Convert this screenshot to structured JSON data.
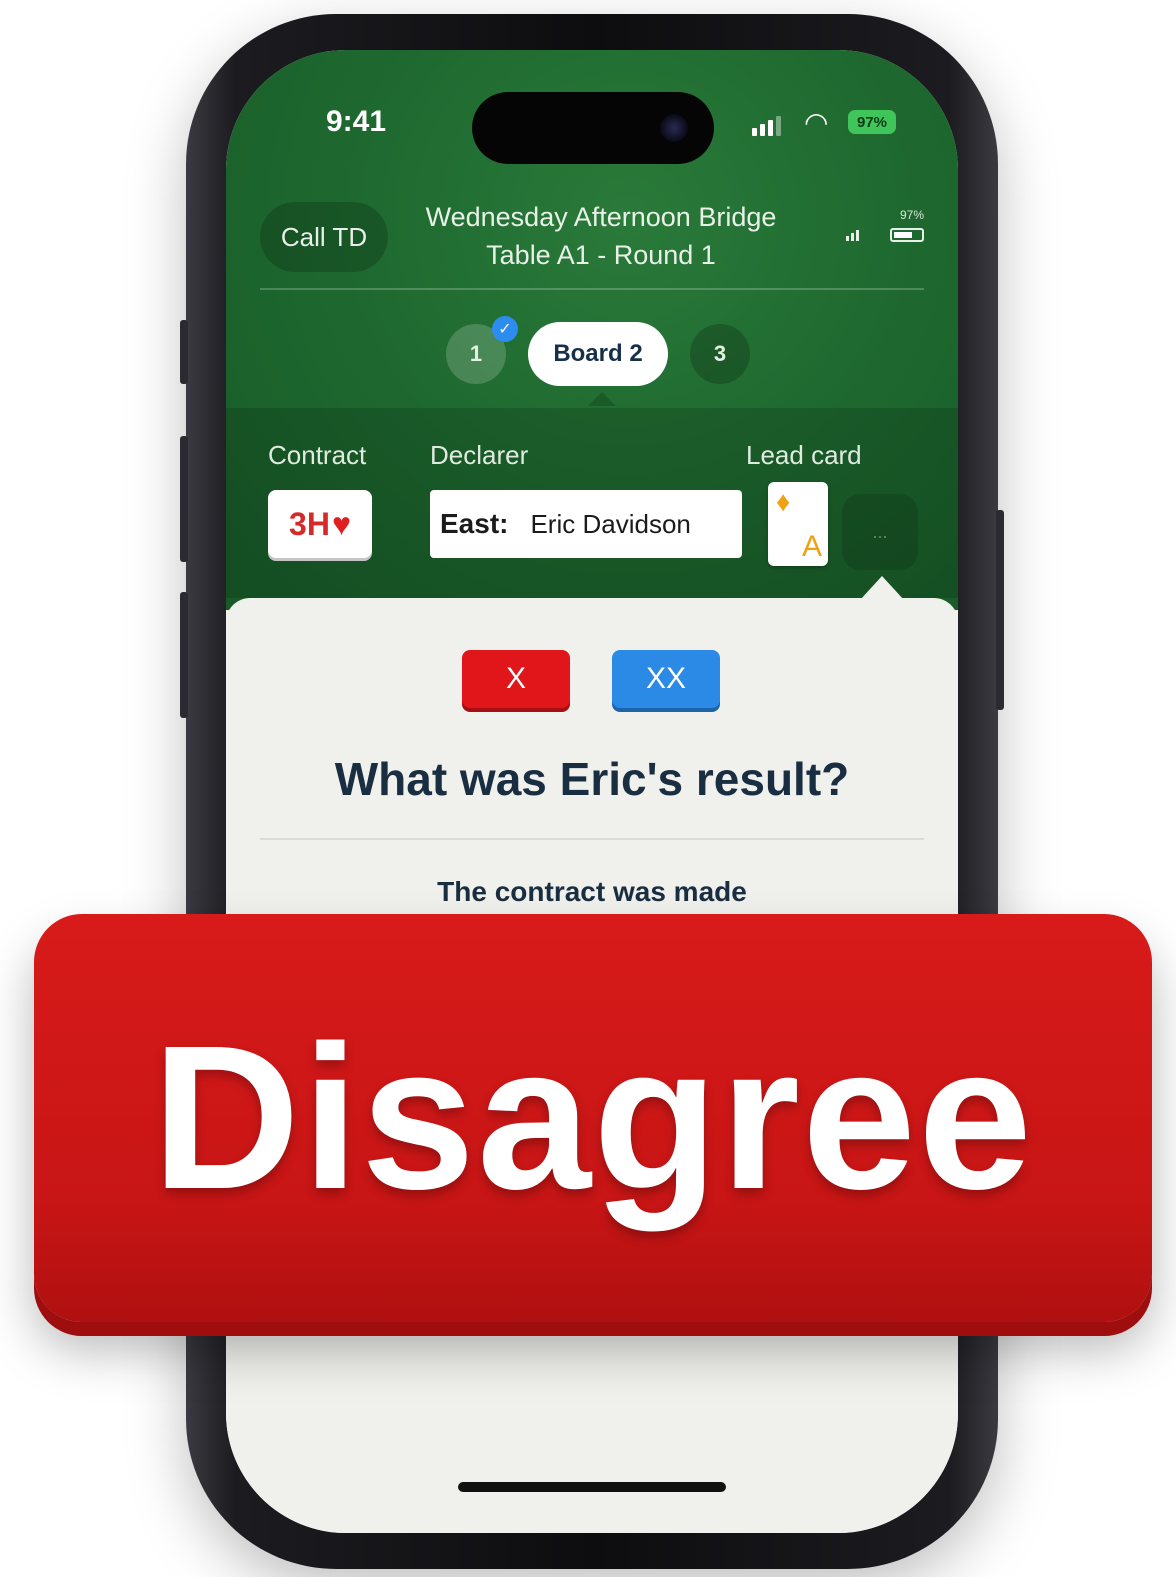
{
  "status_bar": {
    "time": "9:41",
    "battery": "97%"
  },
  "header": {
    "call_td_label": "Call TD",
    "event_name": "Wednesday Afternoon Bridge",
    "table_round": "Table A1 - Round 1",
    "mini_battery_pct": "97%"
  },
  "boards": {
    "tabs": [
      {
        "label": "1",
        "completed": true
      },
      {
        "label": "Board 2",
        "active": true
      },
      {
        "label": "3"
      }
    ]
  },
  "summary": {
    "contract_label": "Contract",
    "contract_value": "3H",
    "declarer_label": "Declarer",
    "declarer_seat": "East:",
    "declarer_name": "Eric Davidson",
    "lead_label": "Lead card",
    "lead_card_rank": "A",
    "lead_card_suit": "diamond",
    "more_label": "..."
  },
  "sheet": {
    "double_label": "X",
    "redouble_label": "XX",
    "question": "What was Eric's result?",
    "result_option": "The contract was made"
  },
  "banner": {
    "text": "Disagree"
  },
  "colors": {
    "felt_green": "#1f6a30",
    "banner_red": "#d81a1a",
    "double_red": "#e0161a",
    "redouble_blue": "#2a8ae6"
  },
  "icons": {
    "heart": "heart-icon",
    "diamond": "diamond-icon",
    "check": "check-icon",
    "wifi": "wifi-icon",
    "signal": "signal-icon",
    "battery": "battery-icon"
  }
}
